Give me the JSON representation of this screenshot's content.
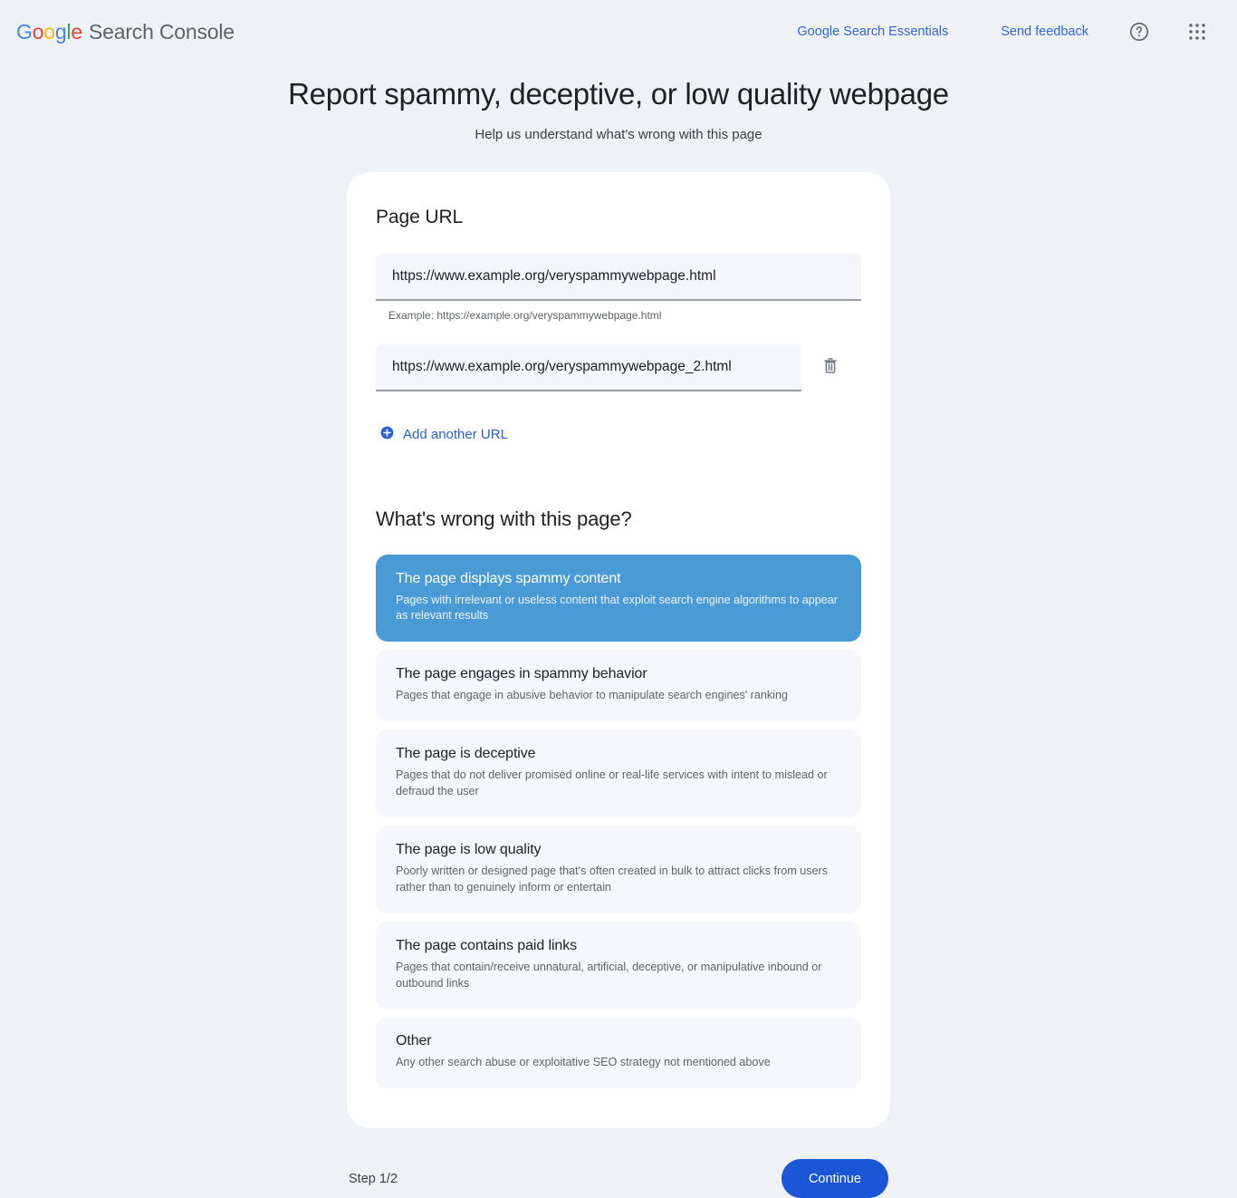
{
  "topbar": {
    "logo_parts": [
      "G",
      "o",
      "o",
      "g",
      "l",
      "e"
    ],
    "product_name": "Search Console",
    "links": [
      {
        "label": "Google Search Essentials"
      },
      {
        "label": "Send feedback"
      }
    ],
    "help_icon": "help-circle-icon",
    "apps_icon": "apps-grid-icon"
  },
  "header": {
    "title": "Report spammy, deceptive, or low quality webpage",
    "subtitle": "Help us understand what's wrong with this page"
  },
  "url_section": {
    "title": "Page URL",
    "fields": [
      {
        "value": "https://www.example.org/veryspammywebpage.html",
        "placeholder": "https://example.org/veryspammywebpage.html"
      },
      {
        "value": "https://www.example.org/veryspammywebpage_2.html",
        "placeholder": "https://example.org/veryspammywebpage.html"
      }
    ],
    "hint": "Example: https://example.org/veryspammywebpage.html",
    "delete_icon": "trash-icon",
    "add_icon": "plus-circle-icon",
    "add_label": "Add another URL"
  },
  "issue_section": {
    "title": "What's wrong with this page?",
    "options": [
      {
        "title": "The page displays spammy content",
        "desc": "Pages with irrelevant or useless content that exploit search engine algorithms to appear as relevant results",
        "selected": true
      },
      {
        "title": "The page engages in spammy behavior",
        "desc": "Pages that engage in abusive behavior to manipulate search engines' ranking",
        "selected": false
      },
      {
        "title": "The page is deceptive",
        "desc": "Pages that do not deliver promised online or real-life services with intent to mislead or defraud the user",
        "selected": false
      },
      {
        "title": "The page is low quality",
        "desc": "Poorly written or designed page that's often created in bulk to attract clicks from users rather than to genuinely inform or entertain",
        "selected": false
      },
      {
        "title": "The page contains paid links",
        "desc": "Pages that contain/receive unnatural, artificial, deceptive, or manipulative inbound or outbound links",
        "selected": false
      },
      {
        "title": "Other",
        "desc": "Any other search abuse or exploitative SEO strategy not mentioned above",
        "selected": false
      }
    ]
  },
  "footer": {
    "step_label": "Step 1/2",
    "continue_label": "Continue"
  },
  "colors": {
    "page_background": "#eef1f6",
    "card_background": "#ffffff",
    "option_background": "#f5f7fc",
    "selected_option": "#4a9bd5",
    "link_blue": "#3367d6",
    "primary_button": "#1a56d6"
  }
}
